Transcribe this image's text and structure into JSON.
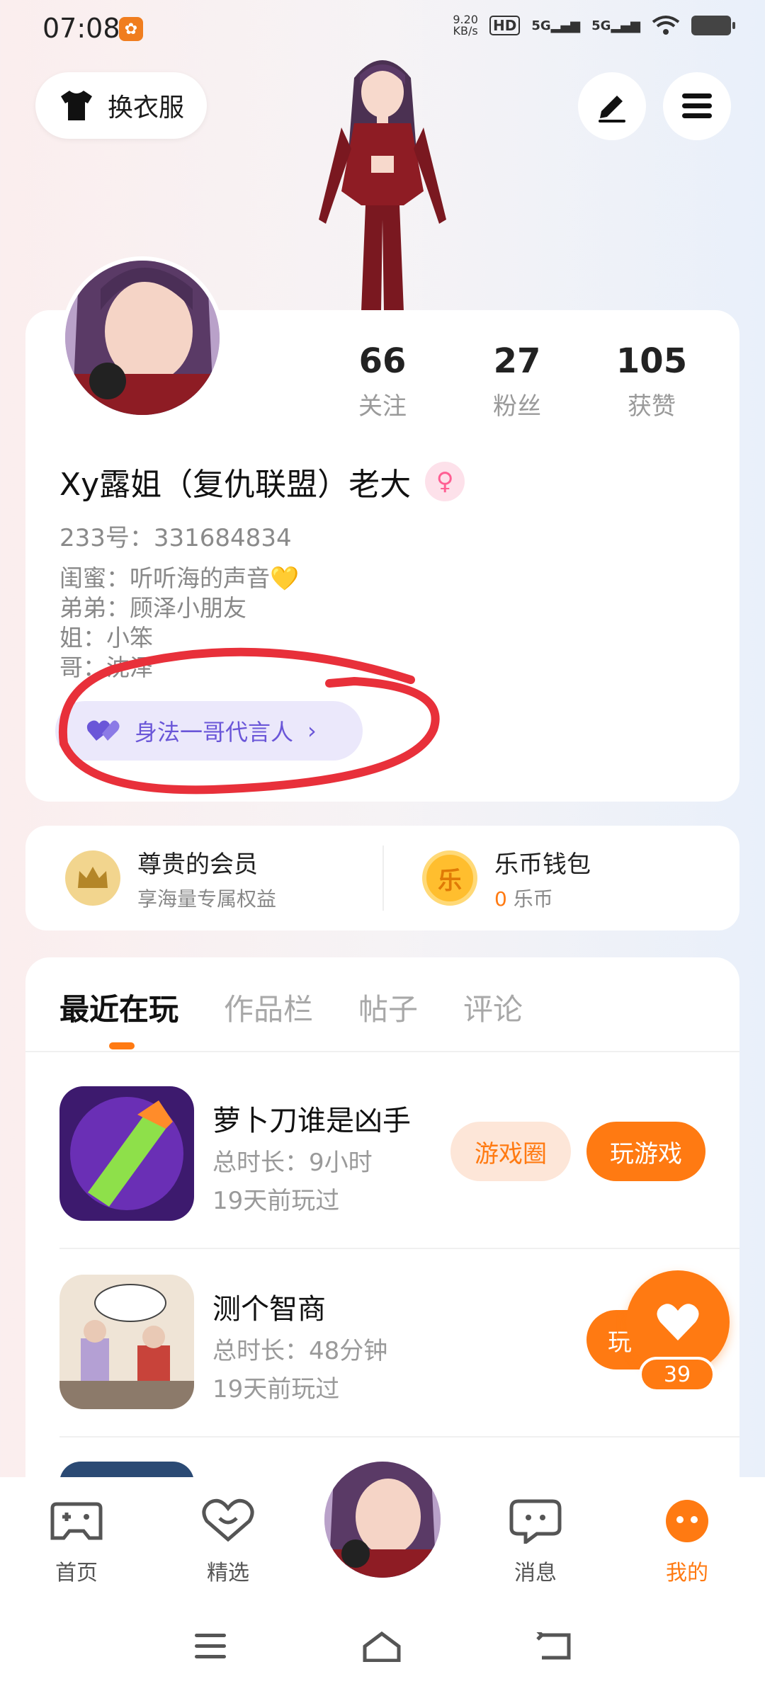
{
  "status_bar": {
    "time": "07:08",
    "app_badge": "✿",
    "net_speed_top": "9.20",
    "net_speed_unit": "KB/s",
    "hd_label": "HD",
    "sig1": "5G",
    "sig2": "5G"
  },
  "top_bar": {
    "outfit_label": "换衣服"
  },
  "profile": {
    "stats": [
      {
        "num": "66",
        "label": "关注"
      },
      {
        "num": "27",
        "label": "粉丝"
      },
      {
        "num": "105",
        "label": "获赞"
      }
    ],
    "nickname": "Xy露姐（复仇联盟）老大",
    "gender_symbol": "♀",
    "uid": "233号：331684834",
    "bio_lines": [
      "闺蜜：听听海的声音💛",
      "弟弟：顾泽小朋友",
      "姐：小笨",
      "哥：沈泽"
    ],
    "endorse_label": "身法一哥代言人",
    "endorse_arrow": "›"
  },
  "membership": {
    "vip_title": "尊贵的会员",
    "vip_sub": "享海量专属权益",
    "wallet_title": "乐币钱包",
    "coin_glyph": "乐",
    "coin_amount": "0",
    "coin_unit": "乐币"
  },
  "tabs": [
    "最近在玩",
    "作品栏",
    "帖子",
    "评论"
  ],
  "games": [
    {
      "title": "萝卜刀谁是凶手",
      "duration": "总时长：9小时",
      "last_played": "19天前玩过",
      "circle_label": "游戏圈",
      "play_label": "玩游戏"
    },
    {
      "title": "测个智商",
      "duration": "总时长：48分钟",
      "last_played": "19天前玩过",
      "play_label": "玩"
    }
  ],
  "fab": {
    "like_count": "39"
  },
  "bottom_nav": [
    {
      "label": "首页"
    },
    {
      "label": "精选"
    },
    {
      "label": "消息"
    },
    {
      "label": "我的"
    }
  ],
  "colors": {
    "accent": "#ff7a12",
    "endorse": "#6a56d8",
    "scribble": "#e8303a"
  }
}
